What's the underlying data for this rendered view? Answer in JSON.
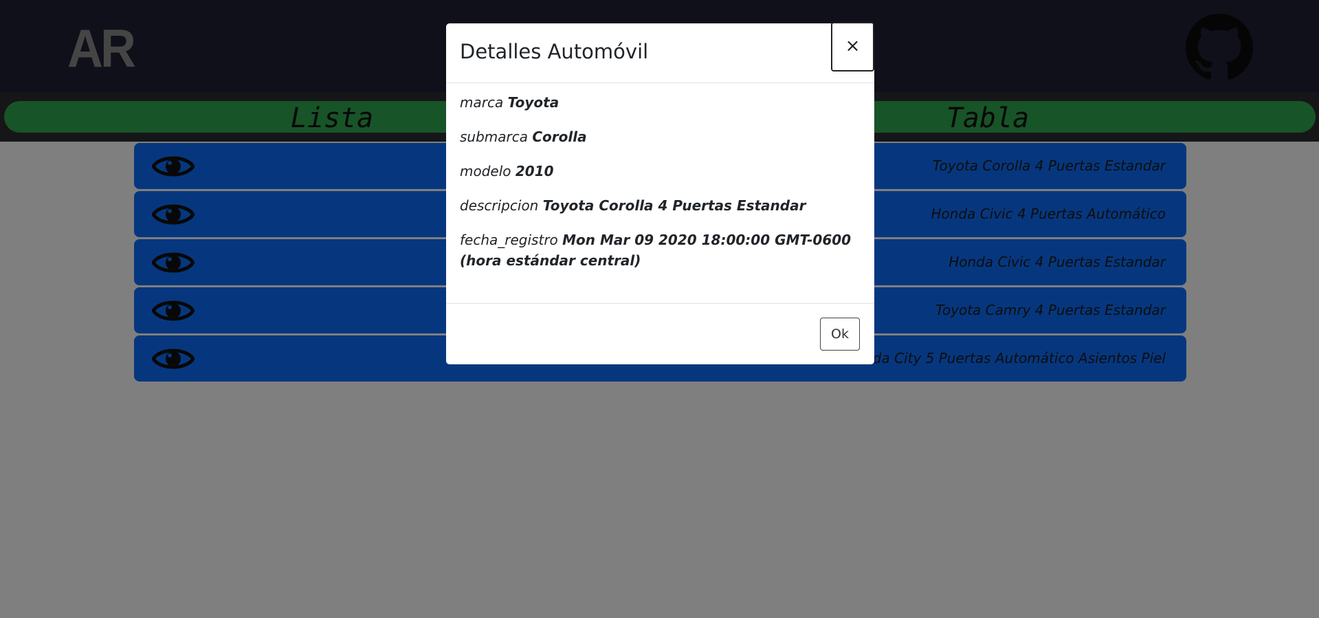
{
  "header": {
    "logo_text": "AR",
    "github_icon": "github-icon"
  },
  "nav": {
    "tabs": [
      {
        "label": "Lista"
      },
      {
        "label": "Tabla"
      }
    ]
  },
  "list": {
    "items": [
      {
        "description": "Toyota Corolla 4 Puertas Estandar"
      },
      {
        "description": "Honda Civic 4 Puertas Automático"
      },
      {
        "description": "Honda Civic 4 Puertas Estandar"
      },
      {
        "description": "Toyota Camry 4 Puertas Estandar"
      },
      {
        "description": "Honda City 5 Puertas Automático Asientos Piel"
      }
    ]
  },
  "modal": {
    "title": "Detalles Automóvil",
    "close_label": "×",
    "fields": [
      {
        "key": "marca",
        "value": "Toyota"
      },
      {
        "key": "submarca",
        "value": "Corolla"
      },
      {
        "key": "modelo",
        "value": "2010"
      },
      {
        "key": "descripcion",
        "value": "Toyota Corolla 4 Puertas Estandar"
      },
      {
        "key": "fecha_registro",
        "value": "Mon Mar 09 2020 18:00:00 GMT-0600 (hora estándar central)"
      }
    ],
    "ok_label": "Ok"
  },
  "colors": {
    "header_bg": "#1f2033",
    "nav_pill": "#2fa84e",
    "row_bg": "#0d6efd"
  }
}
